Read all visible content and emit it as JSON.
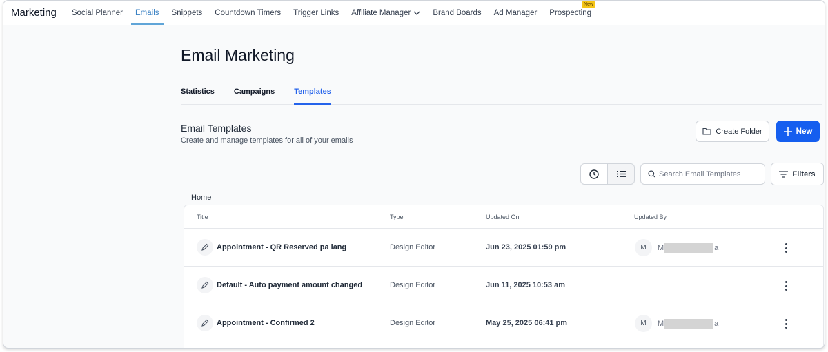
{
  "nav": {
    "brand": "Marketing",
    "items": [
      {
        "label": "Social Planner"
      },
      {
        "label": "Emails",
        "active": true
      },
      {
        "label": "Snippets"
      },
      {
        "label": "Countdown Timers"
      },
      {
        "label": "Trigger Links"
      },
      {
        "label": "Affiliate Manager"
      },
      {
        "label": "Brand Boards"
      },
      {
        "label": "Ad Manager"
      },
      {
        "label": "Prospecting"
      }
    ],
    "new_badge": "New"
  },
  "page": {
    "title": "Email Marketing",
    "tabs": [
      "Statistics",
      "Campaigns",
      "Templates"
    ],
    "active_tab": "Templates"
  },
  "section": {
    "title": "Email Templates",
    "subtitle": "Create and manage templates for all of your emails",
    "create_folder": "Create Folder",
    "new": "New",
    "search_placeholder": "Search Email Templates",
    "filters": "Filters",
    "breadcrumb": "Home"
  },
  "table": {
    "headers": [
      "Title",
      "Type",
      "Updated On",
      "Updated By"
    ],
    "rows": [
      {
        "title": "Appointment - QR Reserved pa lang",
        "type": "Design Editor",
        "updated_on": "Jun 23, 2025 01:59 pm",
        "avatar": "M",
        "user_start": "M",
        "user_end": "a"
      },
      {
        "title": "Default - Auto payment amount changed",
        "type": "Design Editor",
        "updated_on": "Jun 11, 2025 10:53 am"
      },
      {
        "title": "Appointment - Confirmed 2",
        "type": "Design Editor",
        "updated_on": "May 25, 2025 06:41 pm",
        "avatar": "M",
        "user_start": "M",
        "user_end": "a"
      }
    ]
  }
}
